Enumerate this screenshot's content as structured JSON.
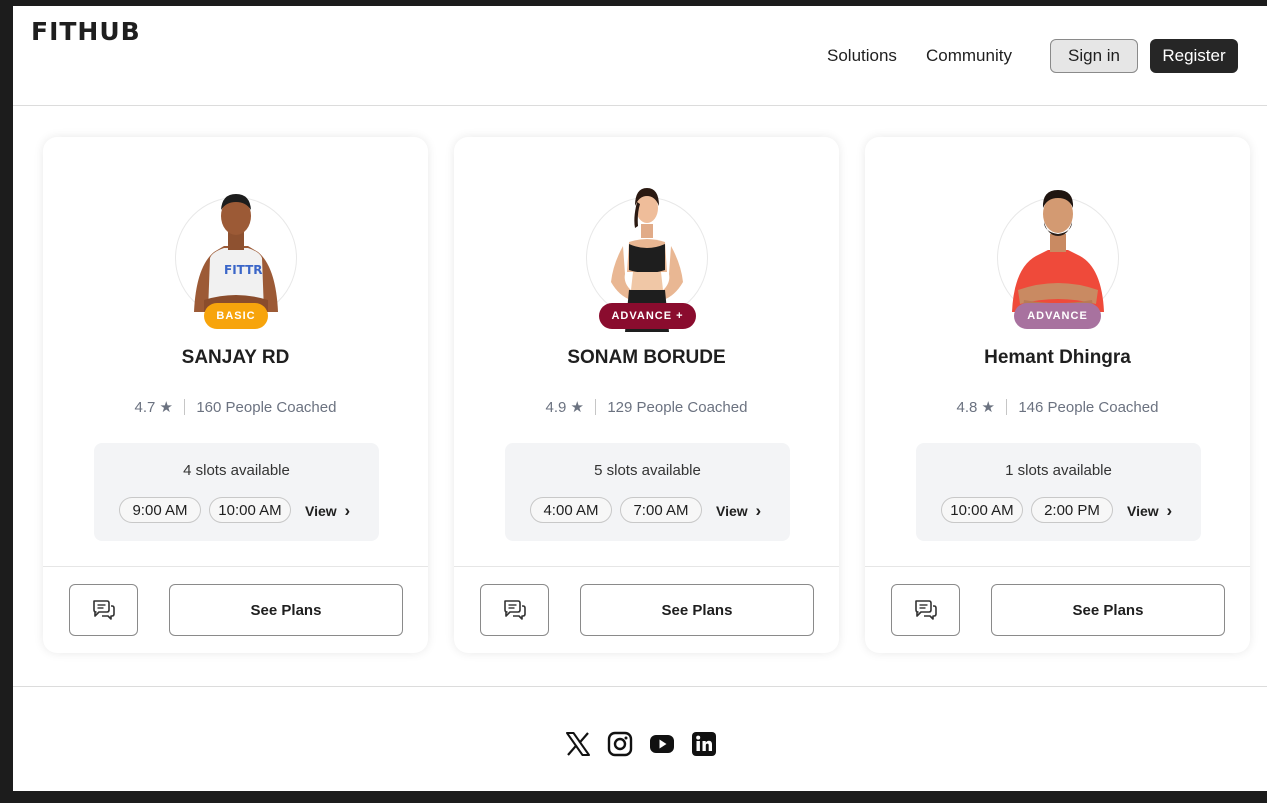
{
  "header": {
    "logo": "FITHUB",
    "nav": {
      "solutions": "Solutions",
      "community": "Community"
    },
    "sign_in": "Sign in",
    "register": "Register"
  },
  "coaches": [
    {
      "name": "SANJAY RD",
      "badge": "BASIC",
      "badge_color": "#f7a40c",
      "rating": "4.7",
      "star": "★",
      "coached": "160 People Coached",
      "slots_text": "4 slots available",
      "times": [
        "9:00 AM",
        "10:00 AM"
      ],
      "view_label": "View",
      "chevron": "›",
      "see_plans": "See Plans"
    },
    {
      "name": "SONAM BORUDE",
      "badge": "ADVANCE +",
      "badge_color": "#8a0c2e",
      "rating": "4.9",
      "star": "★",
      "coached": "129 People Coached",
      "slots_text": "5 slots available",
      "times": [
        "4:00 AM",
        "7:00 AM"
      ],
      "view_label": "View",
      "chevron": "›",
      "see_plans": "See Plans"
    },
    {
      "name": "Hemant Dhingra",
      "badge": "ADVANCE",
      "badge_color": "#a8729f",
      "rating": "4.8",
      "star": "★",
      "coached": "146 People Coached",
      "slots_text": "1 slots available",
      "times": [
        "10:00 AM",
        "2:00 PM"
      ],
      "view_label": "View",
      "chevron": "›",
      "see_plans": "See Plans"
    }
  ],
  "icons": {
    "chat": "chat-icon",
    "social": [
      "x-icon",
      "instagram-icon",
      "youtube-icon",
      "linkedin-icon"
    ]
  },
  "colors": {
    "primary_dark": "#262626",
    "sign_in_bg": "#e6e6e6",
    "slot_box": "#f3f4f6"
  }
}
